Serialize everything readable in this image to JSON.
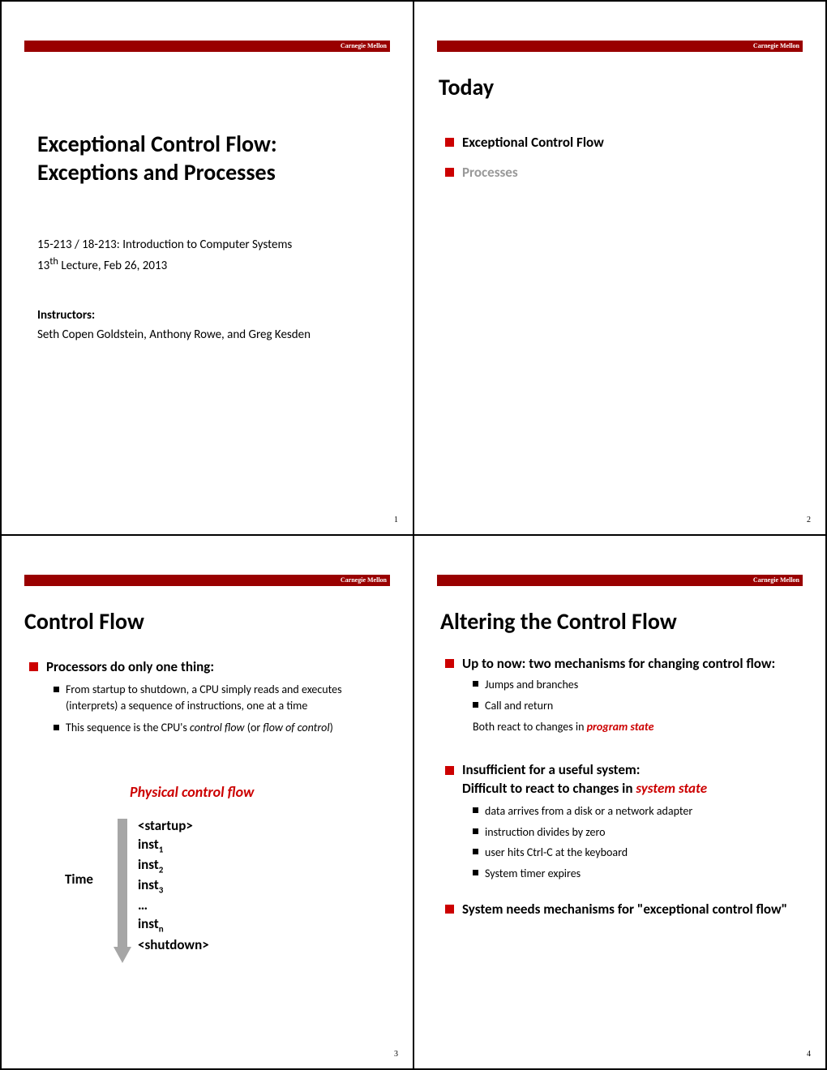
{
  "branding": "Carnegie Mellon",
  "slide1": {
    "title_line1": "Exceptional Control Flow:",
    "title_line2": "Exceptions and Processes",
    "course": "15-213 / 18-213: Introduction to Computer Systems",
    "lecture_pre": "13",
    "lecture_sup": "th",
    "lecture_post": " Lecture, Feb 26, 2013",
    "instr_label": "Instructors:",
    "instr_names": "Seth Copen Goldstein, Anthony Rowe, and Greg Kesden",
    "pagenum": "1"
  },
  "slide2": {
    "title": "Today",
    "bullets": [
      "Exceptional Control Flow",
      "Processes"
    ],
    "pagenum": "2"
  },
  "slide3": {
    "title": "Control Flow",
    "bullet1": "Processors do only one thing:",
    "sub1": "From startup to shutdown, a CPU simply reads and executes (interprets) a sequence of instructions, one at a time",
    "sub2_pre": "This sequence is the CPU's ",
    "sub2_i1": "control flow",
    "sub2_mid": " (or ",
    "sub2_i2": "flow of control",
    "sub2_post": ")",
    "pcf": "Physical control flow",
    "time": "Time",
    "insts": {
      "startup": "<startup>",
      "i1": "inst",
      "s1": "1",
      "i2": "inst",
      "s2": "2",
      "i3": "inst",
      "s3": "3",
      "dots": "…",
      "in": "inst",
      "sn": "n",
      "shutdown": "<shutdown>"
    },
    "pagenum": "3"
  },
  "slide4": {
    "title": "Altering the Control Flow",
    "b1": "Up to now: two mechanisms for changing control flow:",
    "b1s1": "Jumps and branches",
    "b1s2": "Call and return",
    "b1extra_pre": "Both react to changes in ",
    "b1extra_red": "program state",
    "b2_line1": "Insufficient  for a useful system:",
    "b2_line2_pre": "Difficult to react to changes in ",
    "b2_line2_red": "system state",
    "b2subs": [
      "data arrives from a disk or a network adapter",
      "instruction divides by zero",
      "user hits Ctrl-C at the keyboard",
      "System timer expires"
    ],
    "b3": "System needs mechanisms for \"exceptional control flow\"",
    "pagenum": "4"
  }
}
